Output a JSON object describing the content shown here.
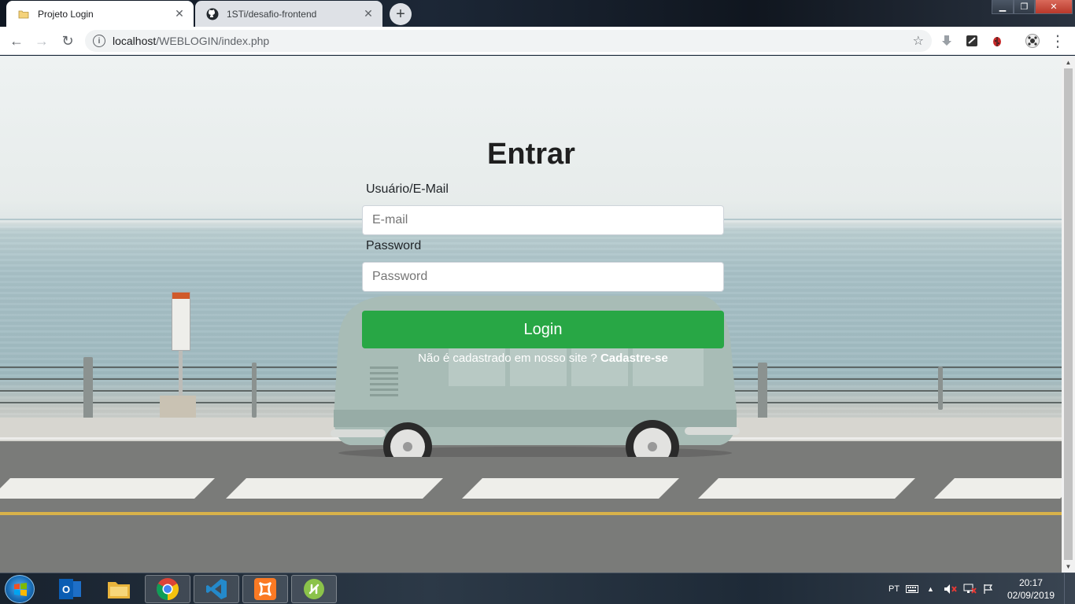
{
  "browser": {
    "tabs": [
      {
        "title": "Projeto Login",
        "icon": "folder-icon",
        "active": true
      },
      {
        "title": "1STi/desafio-frontend",
        "icon": "github-icon",
        "active": false
      }
    ],
    "new_tab_label": "+",
    "close_glyph": "✕",
    "window_controls": {
      "minimize": "▁",
      "maximize": "❐",
      "close": "✕"
    },
    "nav": {
      "back": "←",
      "forward": "→",
      "reload": "↻"
    },
    "url": {
      "host": "localhost",
      "path": "/WEBLOGIN/index.php"
    },
    "info_glyph": "i",
    "bookmark_glyph": "☆",
    "menu_glyph": "⋮"
  },
  "page": {
    "heading": "Entrar",
    "username_label": "Usuário/E-Mail",
    "username_placeholder": "E-mail",
    "password_label": "Password",
    "password_placeholder": "Password",
    "login_button": "Login",
    "signup_text": "Não é cadastrado em nosso site ?",
    "signup_link": "Cadastre-se",
    "accent_color": "#28a745"
  },
  "taskbar": {
    "apps": [
      "outlook-icon",
      "file-explorer-icon",
      "chrome-icon",
      "vscode-icon",
      "xampp-icon",
      "git-icon"
    ],
    "language": "PT",
    "tray_arrow": "▲",
    "time": "20:17",
    "date": "02/09/2019"
  }
}
